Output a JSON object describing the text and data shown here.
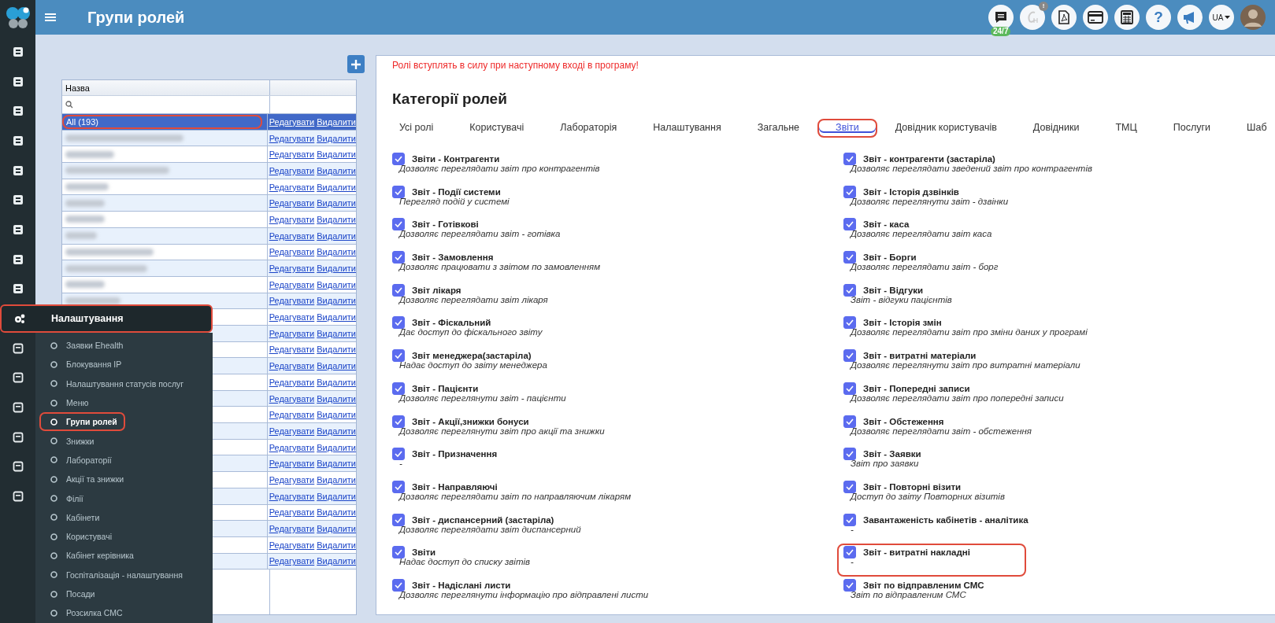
{
  "topbar": {
    "title": "Групи ролей",
    "support_badge": "24/7",
    "alert_badge": "!",
    "help_glyph": "?",
    "language": "UA"
  },
  "settings_menu": {
    "title": "Налаштування",
    "annotated": true,
    "items": [
      {
        "label": "Заявки Ehealth",
        "selected": false,
        "annotated": false
      },
      {
        "label": "Блокування IP",
        "selected": false,
        "annotated": false
      },
      {
        "label": "Налаштування статусів послуг",
        "selected": false,
        "annotated": false
      },
      {
        "label": "Меню",
        "selected": false,
        "annotated": false
      },
      {
        "label": "Групи ролей",
        "selected": true,
        "annotated": true
      },
      {
        "label": "Знижки",
        "selected": false,
        "annotated": false
      },
      {
        "label": "Лабораторії",
        "selected": false,
        "annotated": false
      },
      {
        "label": "Акції та знижки",
        "selected": false,
        "annotated": false
      },
      {
        "label": "Філії",
        "selected": false,
        "annotated": false
      },
      {
        "label": "Кабінети",
        "selected": false,
        "annotated": false
      },
      {
        "label": "Користувачі",
        "selected": false,
        "annotated": false
      },
      {
        "label": "Кабінет керівника",
        "selected": false,
        "annotated": false
      },
      {
        "label": "Госпіталізація - налаштування",
        "selected": false,
        "annotated": false
      },
      {
        "label": "Посади",
        "selected": false,
        "annotated": false
      },
      {
        "label": "Розсилка СМС",
        "selected": false,
        "annotated": false
      }
    ]
  },
  "roles_table": {
    "columns": [
      "Назва"
    ],
    "rows": [
      {
        "name": "All (193)",
        "selected": true,
        "annotated": true,
        "actions": [
          "Редагувати",
          "Видалити"
        ]
      },
      {
        "blurred": true,
        "selected": false,
        "actions": [
          "Редагувати",
          "Видалити"
        ]
      },
      {
        "blurred": true,
        "selected": false,
        "actions": [
          "Редагувати",
          "Видалити"
        ]
      },
      {
        "blurred": true,
        "selected": false,
        "actions": [
          "Редагувати",
          "Видалити"
        ]
      },
      {
        "blurred": true,
        "selected": false,
        "actions": [
          "Редагувати",
          "Видалити"
        ]
      },
      {
        "blurred": true,
        "selected": false,
        "actions": [
          "Редагувати",
          "Видалити"
        ]
      },
      {
        "blurred": true,
        "selected": false,
        "actions": [
          "Редагувати",
          "Видалити"
        ]
      },
      {
        "blurred": true,
        "selected": false,
        "actions": [
          "Редагувати",
          "Видалити"
        ]
      },
      {
        "blurred": true,
        "selected": false,
        "actions": [
          "Редагувати",
          "Видалити"
        ]
      },
      {
        "blurred": true,
        "selected": false,
        "actions": [
          "Редагувати",
          "Видалити"
        ]
      },
      {
        "blurred": true,
        "selected": false,
        "actions": [
          "Редагувати",
          "Видалити"
        ]
      },
      {
        "blurred": true,
        "selected": false,
        "actions": [
          "Редагувати",
          "Видалити"
        ]
      },
      {
        "selected": false,
        "actions": [
          "Редагувати",
          "Видалити"
        ]
      },
      {
        "selected": false,
        "actions": [
          "Редагувати",
          "Видалити"
        ]
      },
      {
        "selected": false,
        "actions": [
          "Редагувати",
          "Видалити"
        ]
      },
      {
        "selected": false,
        "actions": [
          "Редагувати",
          "Видалити"
        ]
      },
      {
        "selected": false,
        "actions": [
          "Редагувати",
          "Видалити"
        ]
      },
      {
        "selected": false,
        "actions": [
          "Редагувати",
          "Видалити"
        ]
      },
      {
        "selected": false,
        "actions": [
          "Редагувати",
          "Видалити"
        ]
      },
      {
        "selected": false,
        "actions": [
          "Редагувати",
          "Видалити"
        ]
      },
      {
        "selected": false,
        "actions": [
          "Редагувати",
          "Видалити"
        ]
      },
      {
        "selected": false,
        "actions": [
          "Редагувати",
          "Видалити"
        ]
      },
      {
        "selected": false,
        "actions": [
          "Редагувати",
          "Видалити"
        ]
      },
      {
        "selected": false,
        "actions": [
          "Редагувати",
          "Видалити"
        ]
      },
      {
        "selected": false,
        "actions": [
          "Редагувати",
          "Видалити"
        ]
      },
      {
        "selected": false,
        "actions": [
          "Редагувати",
          "Видалити"
        ]
      },
      {
        "selected": false,
        "actions": [
          "Редагувати",
          "Видалити"
        ]
      },
      {
        "selected": false,
        "actions": [
          "Редагувати",
          "Видалити"
        ]
      }
    ]
  },
  "panel": {
    "notice": "Ролі вступлять в силу при наступному вході в програму!",
    "title": "Категорії ролей",
    "tabs": [
      {
        "label": "Усі ролі",
        "selected": false,
        "annotated": false
      },
      {
        "label": "Користувачі",
        "selected": false,
        "annotated": false
      },
      {
        "label": "Лабораторія",
        "selected": false,
        "annotated": false
      },
      {
        "label": "Налаштування",
        "selected": false,
        "annotated": false
      },
      {
        "label": "Загальне",
        "selected": false,
        "annotated": false
      },
      {
        "label": "Звіти",
        "selected": true,
        "annotated": true
      },
      {
        "label": "Довідник користувачів",
        "selected": false,
        "annotated": false
      },
      {
        "label": "Довідники",
        "selected": false,
        "annotated": false
      },
      {
        "label": "ТМЦ",
        "selected": false,
        "annotated": false
      },
      {
        "label": "Послуги",
        "selected": false,
        "annotated": false
      },
      {
        "label": "Шаб",
        "selected": false,
        "annotated": false
      }
    ],
    "permissions_left": [
      {
        "title": "Звіти - Контрагенти",
        "description": "Дозволяє переглядати звіт про контрагентів",
        "checked": true
      },
      {
        "title": "Звіт - Події системи",
        "description": "Перегляд подій у системі",
        "checked": true
      },
      {
        "title": "Звіт - Готівкові",
        "description": "Дозволяє переглядати звіт - готівка",
        "checked": true
      },
      {
        "title": "Звіт - Замовлення",
        "description": "Дозволяє працювати з звітом по замовленням",
        "checked": true
      },
      {
        "title": "Звіт лікаря",
        "description": "Дозволяє переглядати звіт лікаря",
        "checked": true
      },
      {
        "title": "Звіт - Фіскальний",
        "description": "Дає доступ до фіскального звіту",
        "checked": true
      },
      {
        "title": "Звіт менеджера(застаріла)",
        "description": "Надає доступ до звіту менеджера",
        "checked": true
      },
      {
        "title": "Звіт - Пацієнти",
        "description": "Дозволяє переглянути звіт - пацієнти",
        "checked": true
      },
      {
        "title": "Звіт - Акції,знижки бонуси",
        "description": "Дозволяє переглянути звіт про акції та знижки",
        "checked": true
      },
      {
        "title": "Звіт - Призначення",
        "description": "-",
        "checked": true
      },
      {
        "title": "Звіт - Направляючі",
        "description": "Дозволяє переглядати звіт по направляючим лікарям",
        "checked": true
      },
      {
        "title": "Звіт - диспансерний (застаріла)",
        "description": "Дозволяє переглядати звіт диспансерний",
        "checked": true
      },
      {
        "title": "Звіти",
        "description": "Надає доступ до списку звітів",
        "checked": true
      },
      {
        "title": "Звіт - Надіслані листи",
        "description": "Дозволяє переглянути інформацію про відправлені листи",
        "checked": true
      }
    ],
    "permissions_right": [
      {
        "title": "Звіт - контрагенти (застаріла)",
        "description": "Дозволяє переглядати зведений звіт про контрагентів",
        "checked": true
      },
      {
        "title": "Звіт - Історія дзвінків",
        "description": "Дозволяє переглянути звіт - дзвінки",
        "checked": true
      },
      {
        "title": "Звіт - каса",
        "description": "Дозволяє переглядати звіт каса",
        "checked": true
      },
      {
        "title": "Звіт - Борги",
        "description": "Дозволяє переглядати звіт - борг",
        "checked": true
      },
      {
        "title": "Звіт - Відгуки",
        "description": "Звіт - відгуки пацієнтів",
        "checked": true
      },
      {
        "title": "Звіт - Історія змін",
        "description": "Дозволяє переглядати звіт про зміни даних у програмі",
        "checked": true
      },
      {
        "title": "Звіт - витратні матеріали",
        "description": "Дозволяє переглянути звіт про витратні матеріали",
        "checked": true
      },
      {
        "title": "Звіт - Попередні записи",
        "description": "Дозволяє переглядати звіт про попередні записи",
        "checked": true
      },
      {
        "title": "Звіт - Обстеження",
        "description": "Дозволяє переглядати звіт - обстеження",
        "checked": true
      },
      {
        "title": "Звіт - Заявки",
        "description": "Звіт про заявки",
        "checked": true
      },
      {
        "title": "Звіт - Повторні візити",
        "description": "Доступ до звіту Повторних візитів",
        "checked": true
      },
      {
        "title": "Завантаженість кабінетів - аналітика",
        "description": "-",
        "checked": true
      },
      {
        "title": "Звіт - витратні накладні",
        "description": "-",
        "checked": true,
        "annotated": true
      },
      {
        "title": "Звіт по відправленим СМС",
        "description": "Звіт по відправленим СМС",
        "checked": true
      }
    ]
  }
}
